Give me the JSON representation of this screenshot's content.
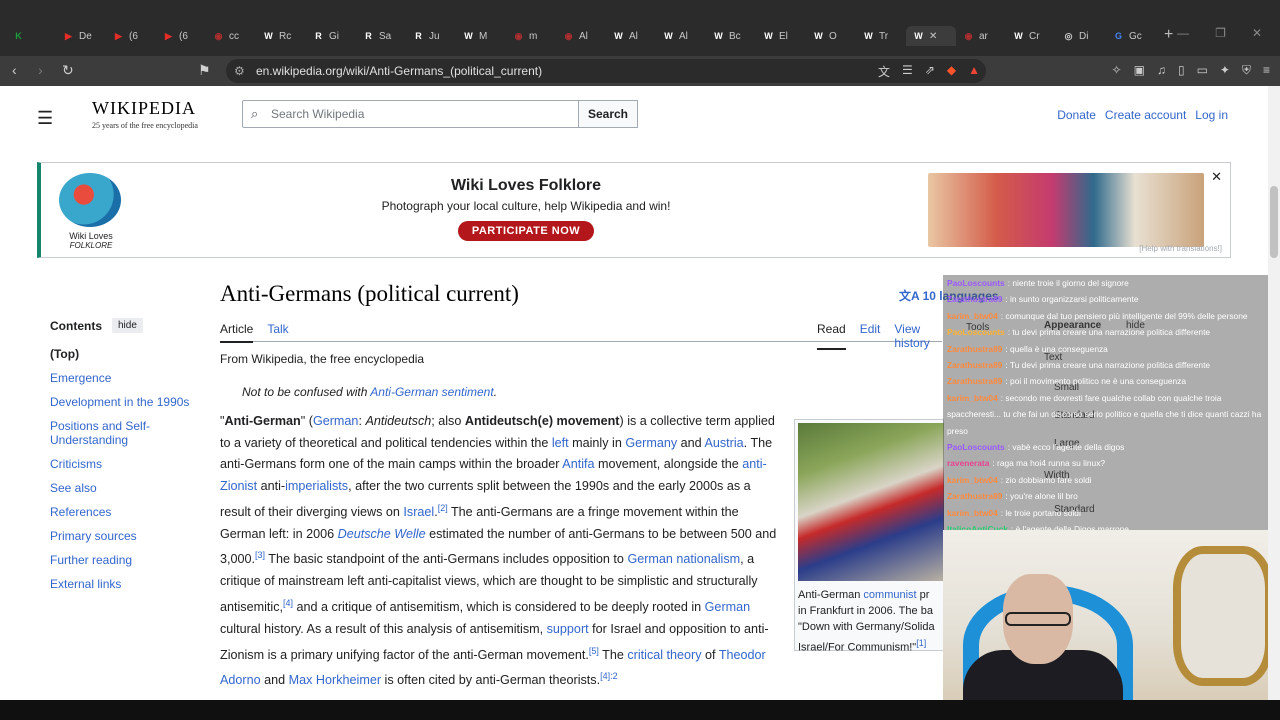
{
  "browser": {
    "tabs": [
      {
        "label": "",
        "color": "#1e9b3b",
        "icon": "K"
      },
      {
        "label": "De",
        "color": "#e52d27",
        "icon": "▶"
      },
      {
        "label": "(6",
        "color": "#e52d27",
        "icon": "▶"
      },
      {
        "label": "(6",
        "color": "#e52d27",
        "icon": "▶"
      },
      {
        "label": "cc",
        "color": "#b02e2e",
        "icon": "◉"
      },
      {
        "label": "Rc",
        "color": "#ffffff",
        "icon": "W"
      },
      {
        "label": "Gi",
        "color": "#ffffff",
        "icon": "R"
      },
      {
        "label": "Sa",
        "color": "#ffffff",
        "icon": "R"
      },
      {
        "label": "Ju",
        "color": "#ffffff",
        "icon": "R"
      },
      {
        "label": "M",
        "color": "#ffffff",
        "icon": "W"
      },
      {
        "label": "m",
        "color": "#b02e2e",
        "icon": "◉"
      },
      {
        "label": "Al",
        "color": "#b02e2e",
        "icon": "◉"
      },
      {
        "label": "Al",
        "color": "#ffffff",
        "icon": "W"
      },
      {
        "label": "Al",
        "color": "#ffffff",
        "icon": "W"
      },
      {
        "label": "Bc",
        "color": "#ffffff",
        "icon": "W"
      },
      {
        "label": "El",
        "color": "#ffffff",
        "icon": "W"
      },
      {
        "label": "O",
        "color": "#ffffff",
        "icon": "W"
      },
      {
        "label": "Tr",
        "color": "#ffffff",
        "icon": "W"
      },
      {
        "label": "✕",
        "color": "#ffffff",
        "icon": "W"
      },
      {
        "label": "ar",
        "color": "#b02e2e",
        "icon": "◉"
      },
      {
        "label": "Cr",
        "color": "#ffffff",
        "icon": "W"
      },
      {
        "label": "Di",
        "color": "#cccccc",
        "icon": "◎"
      },
      {
        "label": "Gc",
        "color": "#4285f4",
        "icon": "G"
      }
    ],
    "url": "en.wikipedia.org/wiki/Anti-Germans_(political_current)"
  },
  "wiki": {
    "logo_word": "WIKIPEDIA",
    "logo_tag": "25 years of the free encyclopedia",
    "search_placeholder": "Search Wikipedia",
    "search_button": "Search",
    "donate": "Donate",
    "create_account": "Create account",
    "log_in": "Log in"
  },
  "banner": {
    "logo_line1": "Wiki Loves",
    "logo_line2": "FOLKLORE",
    "title": "Wiki Loves Folklore",
    "subtitle": "Photograph your local culture, help Wikipedia and win!",
    "button": "PARTICIPATE NOW",
    "help": "[Help with translations!]"
  },
  "toc": {
    "heading": "Contents",
    "hide": "hide",
    "items": [
      "(Top)",
      "Emergence",
      "Development in the 1990s",
      "Positions and Self-Understanding",
      "Criticisms",
      "See also",
      "References",
      "Primary sources",
      "Further reading",
      "External links"
    ]
  },
  "article": {
    "title": "Anti-Germans (political current)",
    "languages": "10 languages",
    "tab_article": "Article",
    "tab_talk": "Talk",
    "tab_read": "Read",
    "tab_edit": "Edit",
    "tab_history": "View history",
    "from": "From Wikipedia, the free encyclopedia",
    "hatnote_prefix": "Not to be confused with ",
    "hatnote_link": "Anti-German sentiment",
    "hatnote_suffix": ".",
    "infobox_caption_1": "Anti-German ",
    "infobox_caption_link": "communist",
    "infobox_caption_2": " pr",
    "infobox_caption_3": "in Frankfurt in 2006. The ba",
    "infobox_caption_4": "\"Down with Germany/Solida",
    "infobox_caption_5": "Israel/For Communism!\"",
    "infobox_caption_ref": "[1]"
  },
  "chat": {
    "messages": [
      {
        "user": "PaoLoscounts",
        "text": ": niente troie il giorno del signore",
        "color": "#9b59ff"
      },
      {
        "user": "Zarathustra89",
        "text": ": in sunto organizzarsi politicamente",
        "color": "#9b59ff"
      },
      {
        "user": "karim_btw04",
        "text": ": comunque dal tuo pensiero più intelligente del 99% delle persone",
        "color": "#ff8a3d"
      },
      {
        "user": "PaoLoscounts",
        "text": ": tu devi prima creare una narrazione politica differente",
        "color": "#ffb22e"
      },
      {
        "user": "Zarathustra89",
        "text": ": quella è una conseguenza",
        "color": "#ff8a3d"
      },
      {
        "user": "Zarathustra89",
        "text": ": Tu devi prima creare una narrazione politica differente",
        "color": "#ff8a3d"
      },
      {
        "user": "Zarathustra89",
        "text": ": poi il movimento politico ne è una conseguenza",
        "color": "#ff8a3d"
      },
      {
        "user": "karim_btw04",
        "text": ": secondo me dovresti fare qualche collab con qualche troia spaccheresti... tu che fai un discorso serio politico e quella che ti dice quanti cazzi ha preso",
        "color": "#ff8a3d"
      },
      {
        "user": "PaoLoscounts",
        "text": ": vabè ecco l'agente della digos",
        "color": "#9b59ff"
      },
      {
        "user": "ravenerata",
        "text": ": raga ma hoi4 runna su linux?",
        "color": "#e84393"
      },
      {
        "user": "karim_btw04",
        "text": ": zio dobbiamo fare soldi",
        "color": "#ff8a3d"
      },
      {
        "user": "Zarathustra89",
        "text": ": you're alone lil bro",
        "color": "#ff8a3d"
      },
      {
        "user": "karim_btw04",
        "text": ": le troie portano soldi",
        "color": "#ff8a3d"
      },
      {
        "user": "ItalicoAntiCuck",
        "text": ": è l'agente della Digos marrone",
        "color": "#2ecc71"
      }
    ]
  },
  "appearance": {
    "tools": "Tools",
    "appearance": "Appearance",
    "hide": "hide",
    "text": "Text",
    "small": "Small",
    "standard": "Standard",
    "large": "Large",
    "width": "Width",
    "standard2": "Standard"
  }
}
